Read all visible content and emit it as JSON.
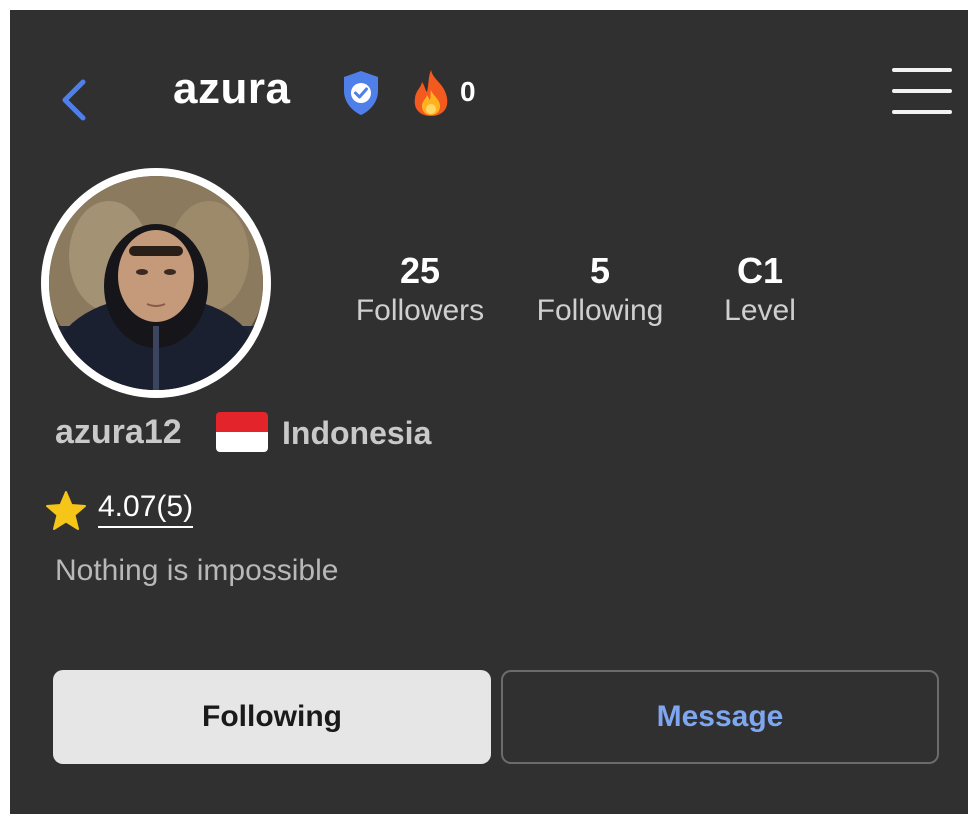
{
  "header": {
    "title": "azura",
    "fire_count": "0",
    "icons": [
      "back-chevron-icon",
      "verified-shield-icon",
      "fire-icon",
      "hamburger-menu-icon"
    ]
  },
  "profile": {
    "stats": [
      {
        "value": "25",
        "label": "Followers"
      },
      {
        "value": "5",
        "label": "Following"
      },
      {
        "value": "C1",
        "label": "Level"
      }
    ],
    "username": "azura12",
    "country": "Indonesia",
    "rating": "4.07(5)",
    "bio": "Nothing is impossible"
  },
  "actions": {
    "following_label": "Following",
    "message_label": "Message"
  },
  "colors": {
    "background": "#303030",
    "accent_blue": "#4f7fe8",
    "message_text": "#7fa6f0",
    "star": "#f5c518"
  }
}
